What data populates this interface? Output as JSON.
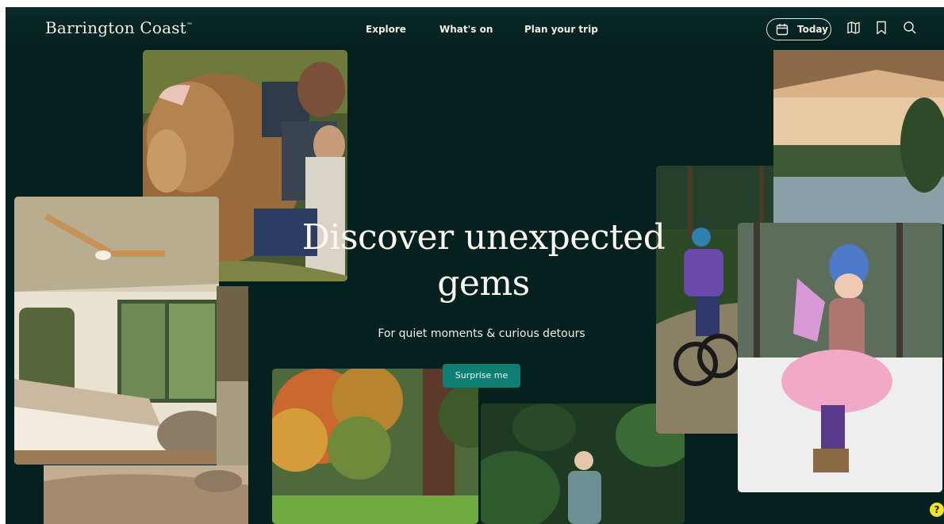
{
  "header": {
    "brand": "Barrington Coast",
    "nav": [
      "Explore",
      "What's on",
      "Plan your trip"
    ],
    "today_label": "Today",
    "icons": [
      "calendar-icon",
      "map-icon",
      "bookmark-icon",
      "search-icon"
    ]
  },
  "hero": {
    "title_line1": "Discover unexpected",
    "title_line2": "gems",
    "subtitle": "For quiet moments & curious detours",
    "cta_label": "Surprise me"
  },
  "photos": [
    "highland-cow-family-photo",
    "glamping-tent-interior-photo",
    "autumn-park-photo",
    "rainforest-hiker-photo",
    "mountain-biker-photo",
    "snow-fairy-girl-photo",
    "tent-lake-view-photo"
  ],
  "colors": {
    "background": "#04211f",
    "accent": "#0f7f73",
    "text": "#fbf6ee"
  }
}
